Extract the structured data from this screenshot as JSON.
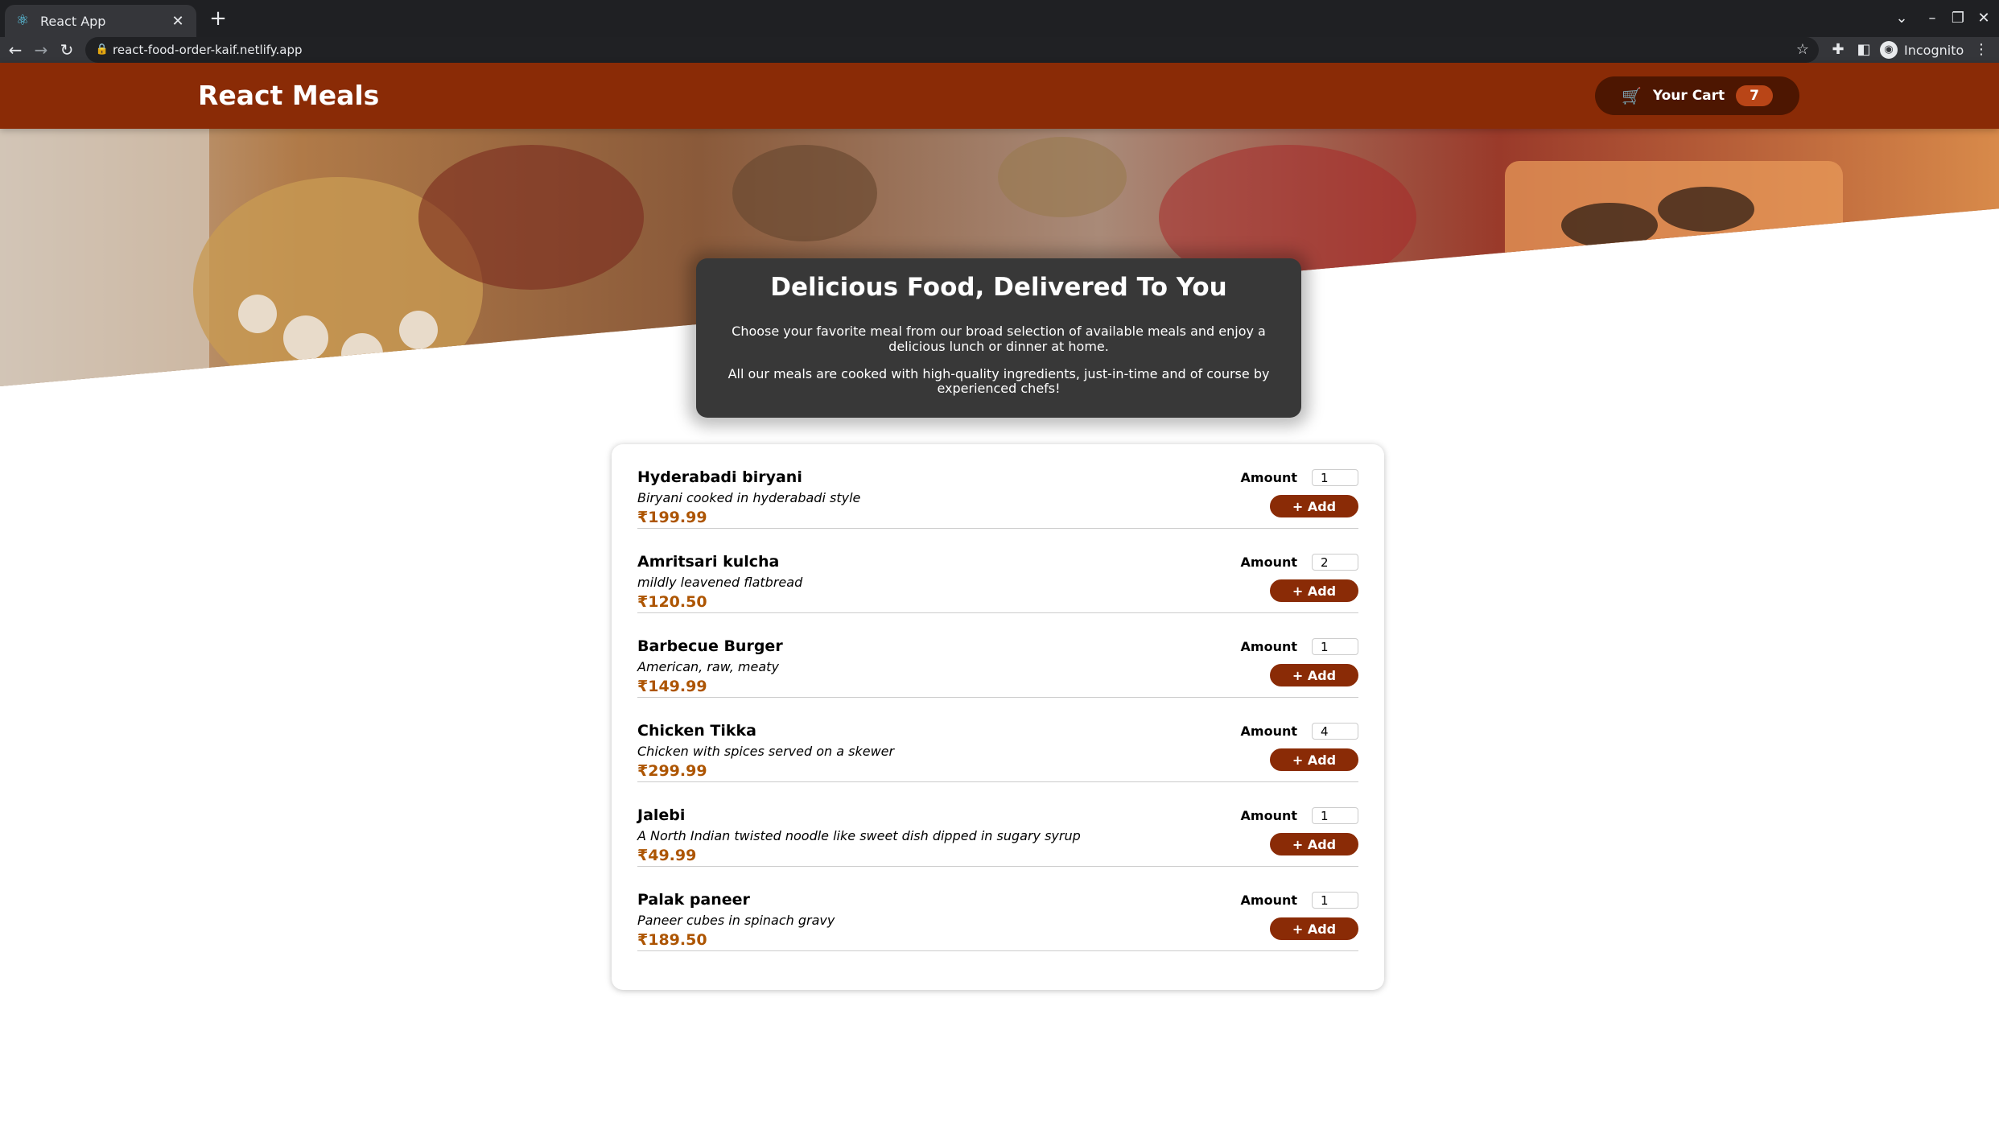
{
  "browser": {
    "tab_title": "React App",
    "url": "react-food-order-kaif.netlify.app",
    "profile_label": "Incognito"
  },
  "header": {
    "title": "React Meals",
    "cart_label": "Your Cart",
    "cart_count": "7"
  },
  "summary": {
    "heading": "Delicious Food, Delivered To You",
    "paragraph1": "Choose your favorite meal from our broad selection of available meals and enjoy a delicious lunch or dinner at home.",
    "paragraph2": "All our meals are cooked with high-quality ingredients, just-in-time and of course by experienced chefs!"
  },
  "meals": {
    "amount_label": "Amount",
    "add_label": "+ Add",
    "items": [
      {
        "name": "Hyderabadi biryani",
        "description": "Biryani cooked in hyderabadi style",
        "price": "₹199.99",
        "amount": "1"
      },
      {
        "name": "Amritsari kulcha",
        "description": "mildly leavened flatbread",
        "price": "₹120.50",
        "amount": "2"
      },
      {
        "name": "Barbecue Burger",
        "description": "American, raw, meaty",
        "price": "₹149.99",
        "amount": "1"
      },
      {
        "name": "Chicken Tikka",
        "description": "Chicken with spices served on a skewer",
        "price": "₹299.99",
        "amount": "4"
      },
      {
        "name": "Jalebi",
        "description": "A North Indian twisted noodle like sweet dish dipped in sugary syrup",
        "price": "₹49.99",
        "amount": "1"
      },
      {
        "name": "Palak paneer",
        "description": "Paneer cubes in spinach gravy",
        "price": "₹189.50",
        "amount": "1"
      }
    ]
  },
  "colors": {
    "header_bg": "#8a2b06",
    "cart_button_bg": "#4d1601",
    "badge_bg": "#b94517",
    "summary_bg": "#383838",
    "price": "#ad5502"
  }
}
